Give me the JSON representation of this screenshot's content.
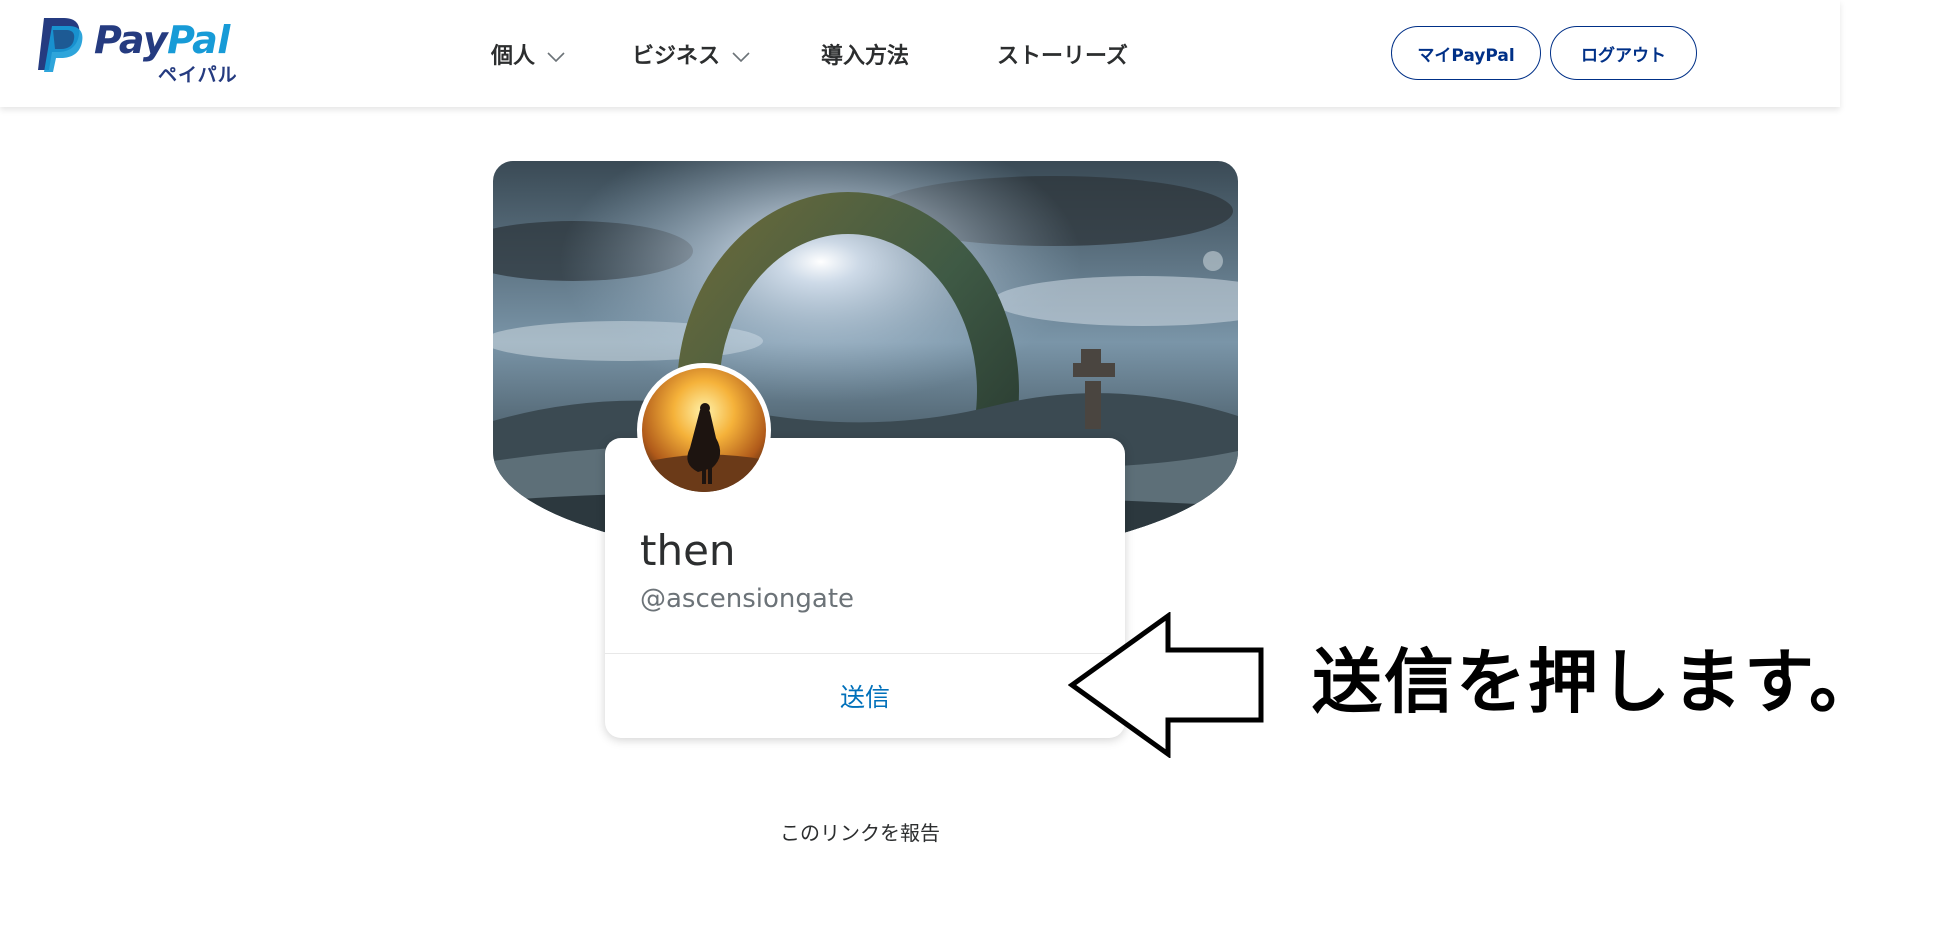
{
  "header": {
    "logo": {
      "wordmark_pay": "Pay",
      "wordmark_pal": "Pal",
      "kana": "ペイパル",
      "icon": "paypal-p-icon"
    },
    "nav": [
      {
        "label": "個人",
        "has_dropdown": true
      },
      {
        "label": "ビジネス",
        "has_dropdown": true
      },
      {
        "label": "導入方法",
        "has_dropdown": false
      },
      {
        "label": "ストーリーズ",
        "has_dropdown": false
      }
    ],
    "buttons": {
      "my_paypal": "マイPayPal",
      "logout": "ログアウト"
    }
  },
  "profile": {
    "display_name": "then",
    "handle": "@ascensiongate",
    "send_label": "送信",
    "banner_image": "portal-ring-landscape",
    "avatar_image": "cloaked-figure-sunset"
  },
  "footer": {
    "report_link": "このリンクを報告"
  },
  "annotation": {
    "text": "送信を押します。",
    "icon": "left-arrow-icon"
  },
  "colors": {
    "brand_dark": "#253b80",
    "brand_light": "#179bd7",
    "link": "#0070ba",
    "button_border": "#003087"
  }
}
